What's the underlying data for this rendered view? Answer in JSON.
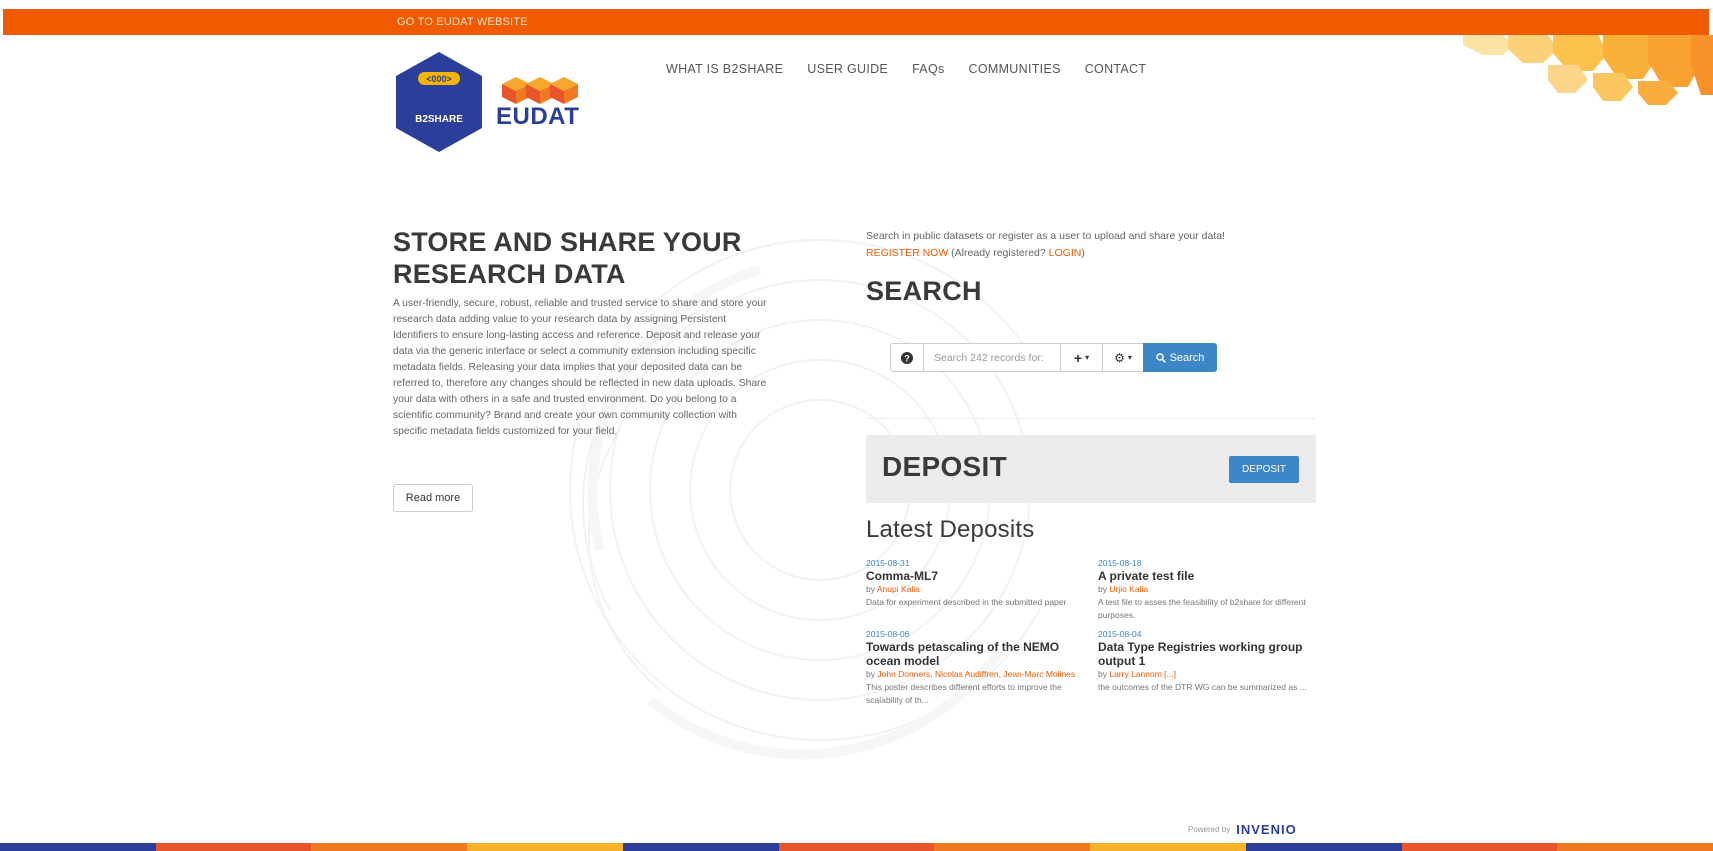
{
  "topbar": {
    "link_label": "GO TO EUDAT WEBSITE"
  },
  "logo": {
    "b2share_text": "B2SHARE",
    "eudat_text": "EUDAT"
  },
  "nav": {
    "items": [
      {
        "label": "WHAT IS B2SHARE"
      },
      {
        "label": "USER GUIDE"
      },
      {
        "label": "FAQs"
      },
      {
        "label": "COMMUNITIES"
      },
      {
        "label": "CONTACT"
      }
    ]
  },
  "hero": {
    "title": "STORE AND SHARE YOUR RESEARCH DATA",
    "text": "A user-friendly, secure, robust, reliable and trusted service to share and store your research data adding value to your research data by assigning Persistent Identifiers to ensure long-lasting access and reference. Deposit and release your data via the generic interface or select a community extension including specific metadata fields. Releasing your data implies that your deposited data can be referred to, therefore any changes should be reflected in new data uploads. Share your data with others in a safe and trusted environment. Do you belong to a scientific community? Brand and create your own community collection with specific metadata fields customized for your field.",
    "read_more_label": "Read more"
  },
  "search": {
    "intro": "Search in public datasets or register as a user to upload and share your data!",
    "register_label": "REGISTER NOW",
    "already_registered": " (Already registered? ",
    "login_label": "LOGIN",
    "closing": ")",
    "title": "SEARCH",
    "placeholder": "Search 242 records for:",
    "button_label": "Search"
  },
  "deposit": {
    "title": "DEPOSIT",
    "button_label": "DEPOSIT"
  },
  "latest": {
    "title": "Latest Deposits",
    "items": [
      {
        "date": "2015-08-31",
        "title": "Comma-ML7",
        "by": "by ",
        "authors": "Anupi Kalia",
        "description": "Data for experiment described in the submitted paper"
      },
      {
        "date": "2015-08-18",
        "title": "A private test file",
        "by": "by ",
        "authors": "Urjio Kalia",
        "description": "A test file to asses the feasibility of b2share for different purposes."
      },
      {
        "date": "2015-08-06",
        "title": "Towards petascaling of the NEMO ocean model",
        "by": "by ",
        "authors": "John Donners, Nicolas Audiffren, Jean-Marc Molines",
        "description": "This poster describes different efforts to improve the scalability of th..."
      },
      {
        "date": "2015-08-04",
        "title": "Data Type Registries working group output 1",
        "by": "by ",
        "authors": "Larry Lannom [...]",
        "description": "the outcomes of the DTR WG can be summarized as ..."
      }
    ]
  },
  "footer": {
    "powered_label": "Powered by",
    "powered_brand": "INVENIO"
  },
  "colors": {
    "brand_orange": "#f05a00",
    "brand_blue": "#2b3e9a",
    "button_blue": "#3d86c8"
  }
}
